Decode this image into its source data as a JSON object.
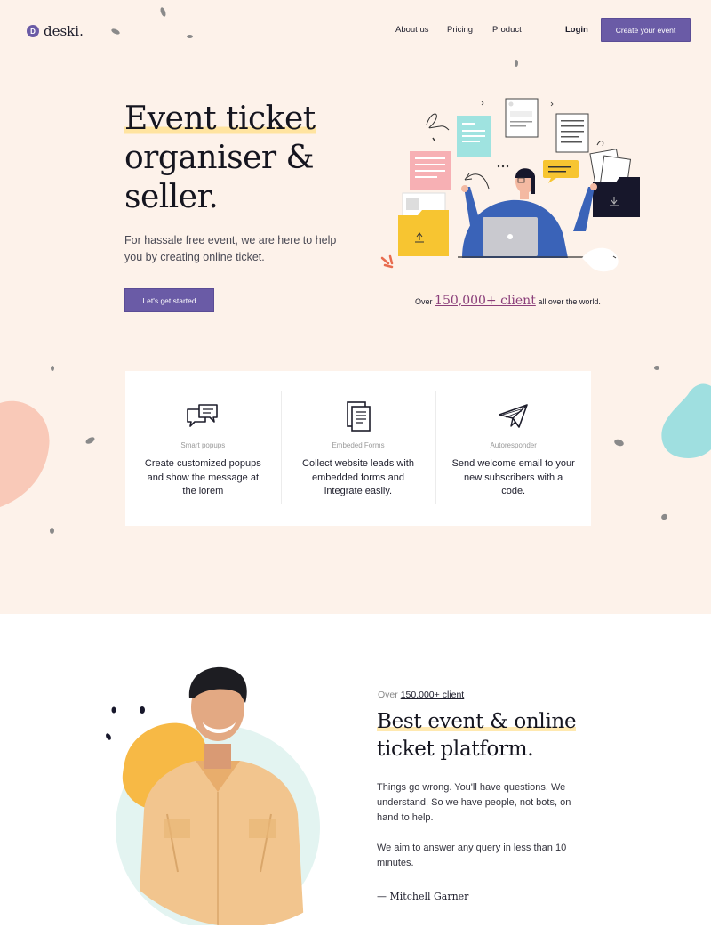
{
  "nav": {
    "logo_letter": "D",
    "logo_text": "deski.",
    "links": [
      "About us",
      "Pricing",
      "Product"
    ],
    "login": "Login",
    "cta": "Create your event"
  },
  "hero": {
    "title_line1": "Event ticket",
    "title_line2": "organiser &",
    "title_line3": "seller.",
    "subtitle": "For hassale free event, we are here to help you by creating online ticket.",
    "button": "Let's get started",
    "client_prefix": "Over",
    "client_count": "150,000+ client",
    "client_suffix": "all over the world."
  },
  "features": [
    {
      "icon": "chat-bubbles-icon",
      "label": "Smart popups",
      "description": "Create customized popups and show the message at the lorem"
    },
    {
      "icon": "documents-icon",
      "label": "Embeded Forms",
      "description": "Collect website leads with embedded forms and integrate easily."
    },
    {
      "icon": "paper-plane-icon",
      "label": "Autoresponder",
      "description": "Send welcome email to your new subscribers with a code."
    }
  ],
  "testimonial": {
    "over_prefix": "Over",
    "over_count": "150,000+ client",
    "title_line1": "Best event & online",
    "title_line2": "ticket platform.",
    "paragraph1": "Things go wrong. You'll have questions. We understand. So we have people, not bots, on hand to help.",
    "paragraph2": "We aim to answer any query in less than 10 minutes.",
    "signature": "— Mitchell Garner"
  },
  "colors": {
    "accent": "#6a5ba6",
    "hero_background": "#fdf2ea",
    "highlight": "#ffe4a0",
    "client_count": "#8b3f7a",
    "blob_pink": "#f9c9b8",
    "blob_teal": "#9fdfe0",
    "blob_orange": "#f7b945"
  }
}
